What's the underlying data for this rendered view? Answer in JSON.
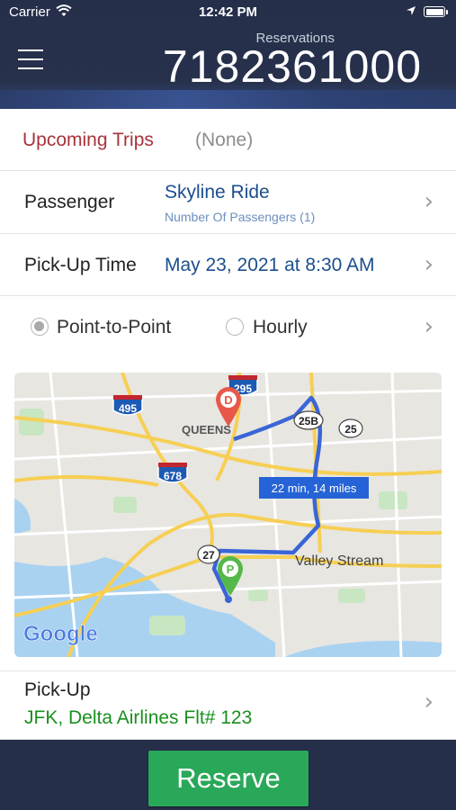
{
  "status_bar": {
    "carrier": "Carrier",
    "time": "12:42 PM"
  },
  "header": {
    "reservations_label": "Reservations",
    "phone": "7182361000"
  },
  "upcoming": {
    "label": "Upcoming Trips",
    "value": "(None)"
  },
  "passenger": {
    "label": "Passenger",
    "name": "Skyline Ride",
    "count_text": "Number Of Passengers (1)"
  },
  "pickup_time": {
    "label": "Pick-Up Time",
    "value": "May 23, 2021 at 8:30 AM"
  },
  "service_type": {
    "options": [
      "Point-to-Point",
      "Hourly"
    ],
    "selected": "Point-to-Point"
  },
  "map": {
    "route_info": "22 min, 14 miles",
    "places": [
      "QUEENS",
      "Valley Stream"
    ],
    "highway_shields": [
      "495",
      "295",
      "678",
      "25B",
      "25",
      "27"
    ],
    "markers": {
      "dropoff": "D",
      "pickup": "P"
    },
    "logo": "Google"
  },
  "pickup": {
    "label": "Pick-Up",
    "value": "JFK, Delta Airlines Flt# 123"
  },
  "footer": {
    "reserve_label": "Reserve"
  },
  "colors": {
    "header_bg": "#252f4a",
    "accent_red": "#a8333b",
    "value_blue": "#1c4e8e",
    "reserve_green": "#2aa85a",
    "pickup_green": "#1a8f1f",
    "route_blue": "#3a65d6"
  }
}
